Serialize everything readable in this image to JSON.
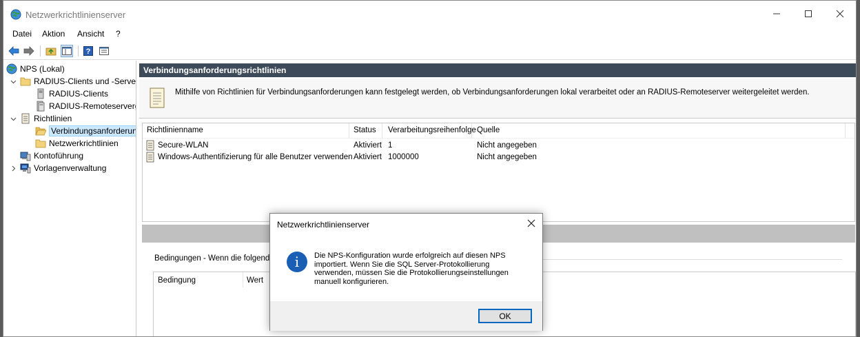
{
  "window": {
    "title": "Netzwerkrichtlinienserver"
  },
  "menu": [
    "Datei",
    "Aktion",
    "Ansicht",
    "?"
  ],
  "tree": {
    "items": [
      {
        "label": "NPS (Lokal)"
      },
      {
        "label": "RADIUS-Clients und -Server"
      },
      {
        "label": "RADIUS-Clients"
      },
      {
        "label": "RADIUS-Remoteservergruppen"
      },
      {
        "label": "Richtlinien"
      },
      {
        "label": "Verbindungsanforderungsrichtlinien"
      },
      {
        "label": "Netzwerkrichtlinien"
      },
      {
        "label": "Kontoführung"
      },
      {
        "label": "Vorlagenverwaltung"
      }
    ]
  },
  "pane": {
    "header": "Verbindungsanforderungsrichtlinien",
    "info": "Mithilfe von Richtlinien für Verbindungsanforderungen kann festgelegt werden, ob Verbindungsanforderungen lokal verarbeitet oder an RADIUS-Remoteserver weitergeleitet werden.",
    "columns": [
      "Richtlinienname",
      "Status",
      "Verarbeitungsreihenfolge",
      "Quelle"
    ],
    "rows": [
      {
        "name": "Secure-WLAN",
        "status": "Aktiviert",
        "order": "1",
        "source": "Nicht angegeben"
      },
      {
        "name": "Windows-Authentifizierung für alle Benutzer verwenden",
        "status": "Aktiviert",
        "order": "1000000",
        "source": "Nicht angegeben"
      }
    ],
    "conditions_label": "Bedingungen - Wenn die folgenden",
    "conditions_columns": [
      "Bedingung",
      "Wert"
    ]
  },
  "dialog": {
    "title": "Netzwerkrichtlinienserver",
    "message_lines": [
      "Die NPS-Konfiguration wurde erfolgreich auf diesen NPS",
      "importiert. Wenn Sie die SQL Server-Protokollierung",
      "verwenden, müssen Sie die Protokollierungseinstellungen",
      "manuell konfigurieren."
    ],
    "ok_label": "OK"
  },
  "colors": {
    "pane_header_bg": "#3d4a5a",
    "selection_bg": "#cce8ff",
    "info_icon": "#1a5fb4",
    "ok_border": "#0067c0"
  },
  "icons": {
    "app": "globe-server-icon",
    "back": "arrow-left-icon",
    "forward": "arrow-right-icon",
    "up": "folder-up-icon",
    "showhide": "console-tree-icon",
    "help": "help-icon",
    "properties": "properties-icon",
    "dialog": "info-icon"
  }
}
